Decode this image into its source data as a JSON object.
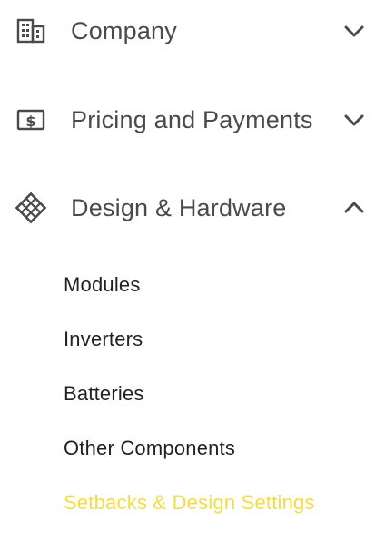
{
  "menu": {
    "sections": [
      {
        "label": "Company",
        "icon": "building-icon",
        "expanded": false
      },
      {
        "label": "Pricing and Payments",
        "icon": "money-icon",
        "expanded": false
      },
      {
        "label": "Design & Hardware",
        "icon": "grid-diamond-icon",
        "expanded": true
      }
    ],
    "design_hardware_items": [
      {
        "label": "Modules",
        "active": false
      },
      {
        "label": "Inverters",
        "active": false
      },
      {
        "label": "Batteries",
        "active": false
      },
      {
        "label": "Other Components",
        "active": false
      },
      {
        "label": "Setbacks & Design Settings",
        "active": true
      }
    ]
  },
  "colors": {
    "text": "#4a4a4a",
    "sub_text": "#222222",
    "active": "#f4dc45"
  }
}
